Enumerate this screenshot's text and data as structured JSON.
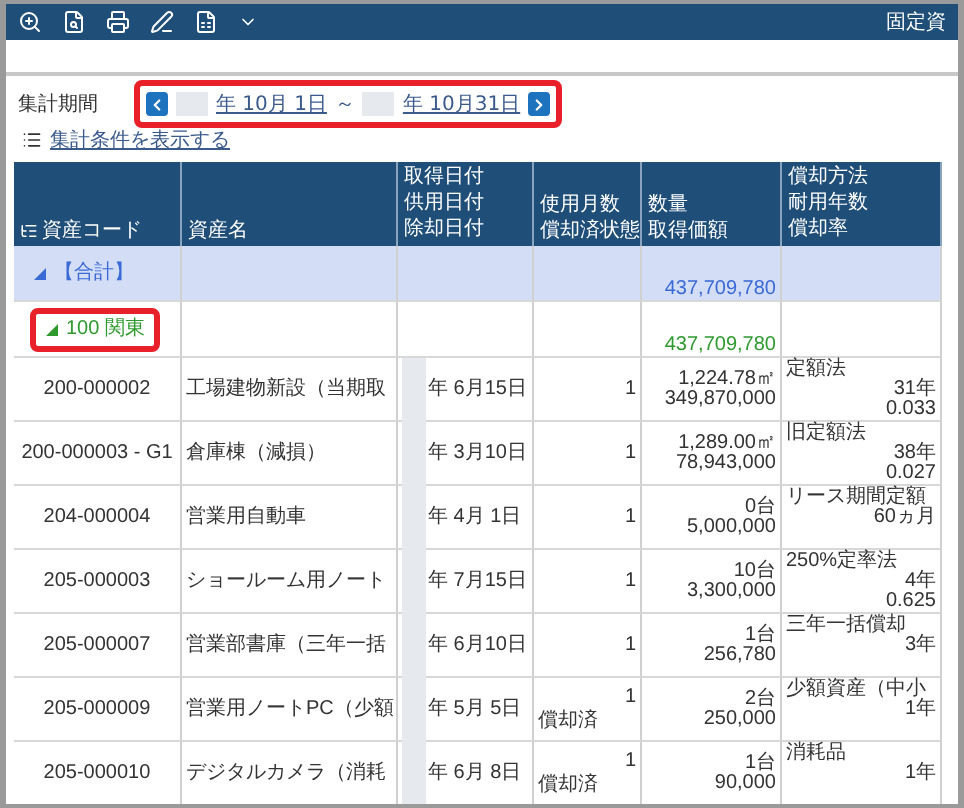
{
  "toolbar": {
    "title": "固定資"
  },
  "period": {
    "label": "集計期間",
    "start": "年 10月 1日",
    "separator": "～",
    "end": "年 10月31日",
    "highlighted": true
  },
  "conditions_link": "集計条件を表示する",
  "table": {
    "columns": [
      {
        "lines": [
          "資産コード"
        ]
      },
      {
        "lines": [
          "資産名"
        ]
      },
      {
        "lines": [
          "取得日付",
          "供用日付",
          "除却日付"
        ]
      },
      {
        "lines": [
          "使用月数",
          "償却済状態"
        ]
      },
      {
        "lines": [
          "数量",
          "取得価額"
        ]
      },
      {
        "lines": [
          "償却方法",
          "耐用年数",
          "償却率"
        ]
      }
    ],
    "total": {
      "label": "【合計】",
      "expanded": true,
      "amount": "437,709,780"
    },
    "group": {
      "label": "100 関東",
      "expanded": true,
      "highlighted": true,
      "amount": "437,709,780"
    },
    "rows": [
      {
        "code": "200-000002",
        "name": "工場建物新設（当期取",
        "date": "年 6月15日",
        "months": "1",
        "quantity": "1,224.78㎡",
        "price": "349,870,000",
        "method": "定額法",
        "life": "31年",
        "rate": "0.033"
      },
      {
        "code": "200-000003 - G1",
        "name": "倉庫棟（減損）",
        "date": "年 3月10日",
        "months": "1",
        "quantity": "1,289.00㎡",
        "price": "78,943,000",
        "method": "旧定額法",
        "life": "38年",
        "rate": "0.027"
      },
      {
        "code": "204-000004",
        "name": "営業用自動車",
        "date": "年 4月 1日",
        "months": "1",
        "quantity": "0台",
        "price": "5,000,000",
        "method": "リース期間定額",
        "life": "60ヵ月"
      },
      {
        "code": "205-000003",
        "name": "ショールーム用ノート",
        "date": "年 7月15日",
        "months": "1",
        "quantity": "10台",
        "price": "3,300,000",
        "method": "250%定率法",
        "life": "4年",
        "rate": "0.625"
      },
      {
        "code": "205-000007",
        "name": "営業部書庫（三年一括",
        "date": "年 6月10日",
        "months": "1",
        "quantity": "1台",
        "price": "256,780",
        "method": "三年一括償却",
        "life": "3年"
      },
      {
        "code": "205-000009",
        "name": "営業用ノートPC（少額",
        "date": "年 5月 5日",
        "months": "1",
        "status": "償却済",
        "quantity": "2台",
        "price": "250,000",
        "method": "少額資産（中小",
        "life": "1年"
      },
      {
        "code": "205-000010",
        "name": "デジタルカメラ（消耗",
        "date": "年 6月 8日",
        "months": "1",
        "status": "償却済",
        "quantity": "1台",
        "price": "90,000",
        "method": "消耗品",
        "life": "1年"
      }
    ]
  }
}
